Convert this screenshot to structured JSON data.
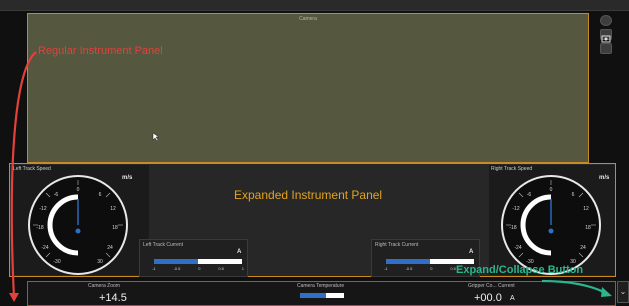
{
  "camera": {
    "label": "Camera"
  },
  "annotations": {
    "regular": "Regular Instrument Panel",
    "expanded": "Expanded Instrument Panel",
    "expand_collapse": "Expand/Collapse Button"
  },
  "left_gauge": {
    "title": "Left Track Speed",
    "unit": "m/s"
  },
  "right_gauge": {
    "title": "Right Track Speed",
    "unit": "m/s"
  },
  "left_current": {
    "title": "Left Track Current",
    "unit": "A",
    "ticks": [
      "-1",
      "-0.5",
      "0",
      "0.5",
      "1"
    ]
  },
  "right_current": {
    "title": "Right Track Current",
    "unit": "A",
    "ticks": [
      "-1",
      "-0.5",
      "0",
      "0.5",
      "1"
    ]
  },
  "bottom": {
    "zoom_label": "Camera Zoom",
    "zoom_value": "+14.5",
    "temp_label": "Camera Temperature",
    "gripper_label": "Gripper Co... Current",
    "gripper_value": "+00.0",
    "gripper_unit": "A"
  },
  "colors": {
    "panel_border": "#c98a24",
    "annotation_red": "#e2413c",
    "annotation_teal": "#2ab58c",
    "bar_fill": "#2f6fc5"
  },
  "icons": {
    "collapse": "chevron-down-icon"
  }
}
